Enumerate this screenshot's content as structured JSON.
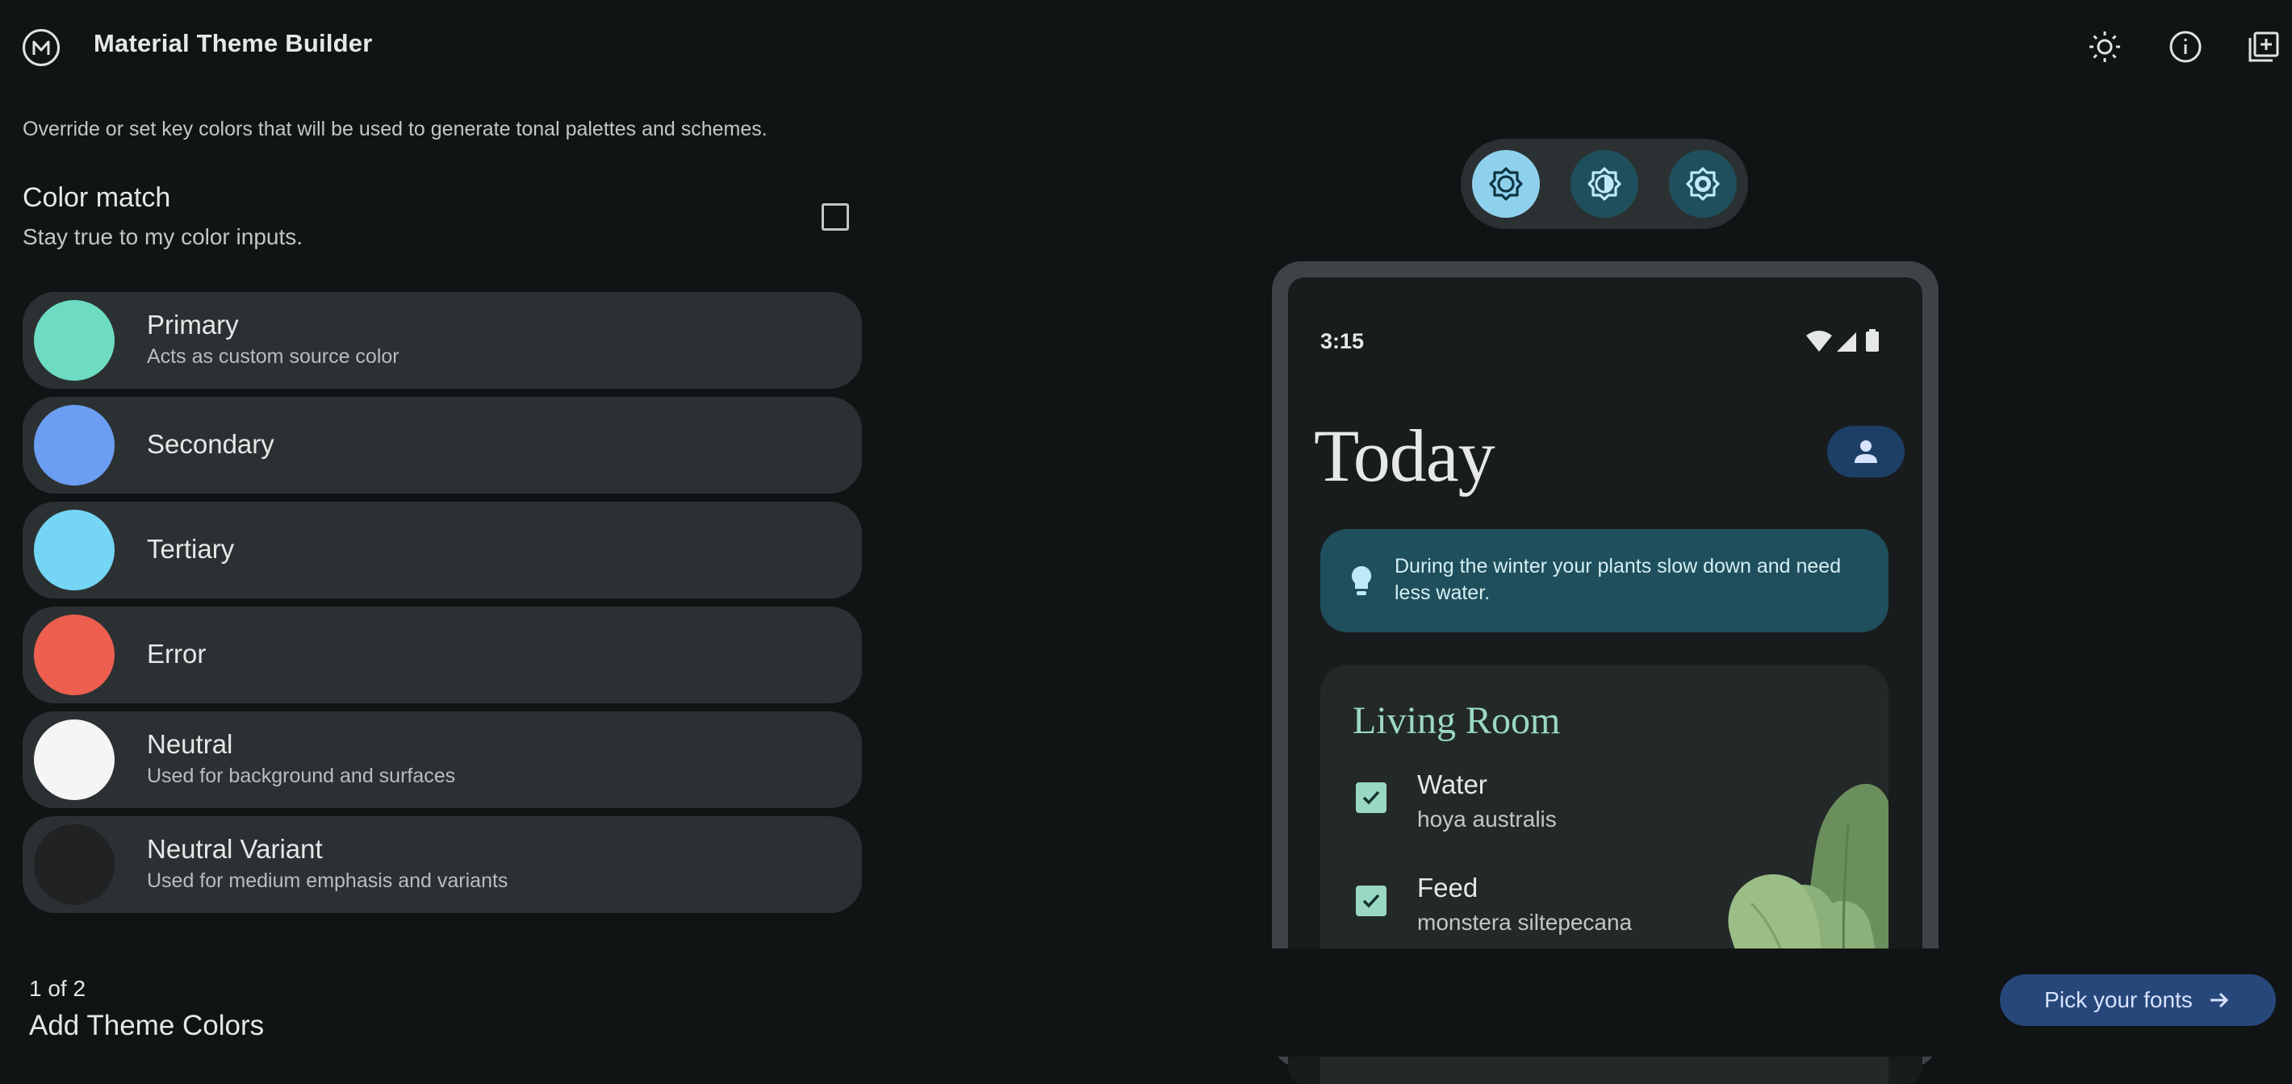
{
  "header": {
    "title": "Material Theme Builder"
  },
  "left": {
    "description": "Override or set key colors that will be used to generate tonal palettes and schemes.",
    "color_match": {
      "title": "Color match",
      "subtitle": "Stay true to my color inputs.",
      "checked": false
    },
    "colors": [
      {
        "label": "Primary",
        "subtitle": "Acts as custom source color",
        "color": "#6ddcc3"
      },
      {
        "label": "Secondary",
        "subtitle": "",
        "color": "#6b9ef2"
      },
      {
        "label": "Tertiary",
        "subtitle": "",
        "color": "#74d5f5"
      },
      {
        "label": "Error",
        "subtitle": "",
        "color": "#ee5f50"
      },
      {
        "label": "Neutral",
        "subtitle": "Used for background and surfaces",
        "color": "#f5f5f5"
      },
      {
        "label": "Neutral Variant",
        "subtitle": "Used for medium emphasis and variants",
        "color": "#202223"
      }
    ],
    "step": "1 of 2",
    "step_title": "Add Theme Colors"
  },
  "preview": {
    "time": "3:15",
    "title": "Today",
    "tip": "During the winter your plants slow down and need less water.",
    "room": {
      "title": "Living Room",
      "tasks": [
        {
          "name": "Water",
          "plant": "hoya australis",
          "checked": true
        },
        {
          "name": "Feed",
          "plant": "monstera siltepecana",
          "checked": true
        }
      ]
    }
  },
  "next_button": {
    "label": "Pick your fonts"
  },
  "icons": {
    "header": [
      "light-mode-icon",
      "info-icon",
      "export-icon"
    ],
    "modes": [
      "standard-contrast-icon",
      "medium-contrast-icon",
      "high-contrast-icon"
    ]
  }
}
